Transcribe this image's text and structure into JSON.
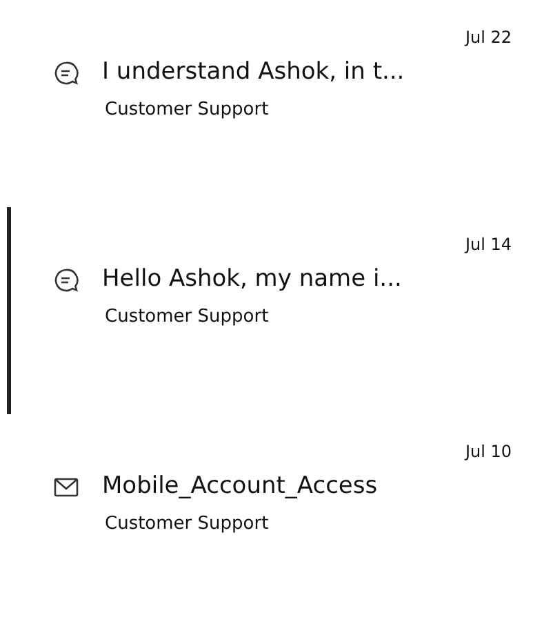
{
  "conversations": [
    {
      "kind": "chat",
      "date": "Jul 22",
      "title": "I understand Ashok, in t...",
      "subtitle": "Customer Support",
      "selected": false
    },
    {
      "kind": "chat",
      "date": "Jul 14",
      "title": "Hello Ashok, my name i...",
      "subtitle": "Customer Support",
      "selected": true
    },
    {
      "kind": "email",
      "date": "Jul 10",
      "title": "Mobile_Account_Access",
      "subtitle": "Customer Support",
      "selected": false
    }
  ]
}
